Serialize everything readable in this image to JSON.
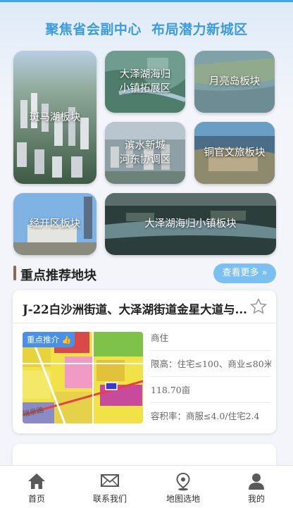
{
  "header": {
    "headline": "聚焦省会副中心  布局潜力新城区"
  },
  "tiles": [
    {
      "label": "斑马湖板块"
    },
    {
      "label": "大泽湖海归\n小镇拓展区"
    },
    {
      "label": "月亮岛板块"
    },
    {
      "label": "滨水新城\n河东协调区"
    },
    {
      "label": "铜官文旅板块"
    },
    {
      "label": "经开区板块"
    },
    {
      "label": "大泽湖海归小镇板块"
    }
  ],
  "section": {
    "title": "重点推荐地块",
    "more_label": "查看更多"
  },
  "card": {
    "title": "J-22白沙洲街道、大泽湖街道金星大道与...",
    "badge": "重点推介",
    "map_label": "瑞泉路",
    "attrs": [
      "商住",
      "限高：住宅≤100、商业≤80米",
      "118.70亩",
      "容积率：商服≤4.0/住宅2.4"
    ]
  },
  "tabbar": [
    {
      "label": "首页",
      "icon": "home-icon"
    },
    {
      "label": "联系我们",
      "icon": "mail-icon"
    },
    {
      "label": "地图选地",
      "icon": "map-pin-icon"
    },
    {
      "label": "我的",
      "icon": "user-icon"
    }
  ],
  "colors": {
    "accent": "#3b9be0",
    "more_button": "#7cc0f2",
    "badge": "#4a8fe8"
  }
}
